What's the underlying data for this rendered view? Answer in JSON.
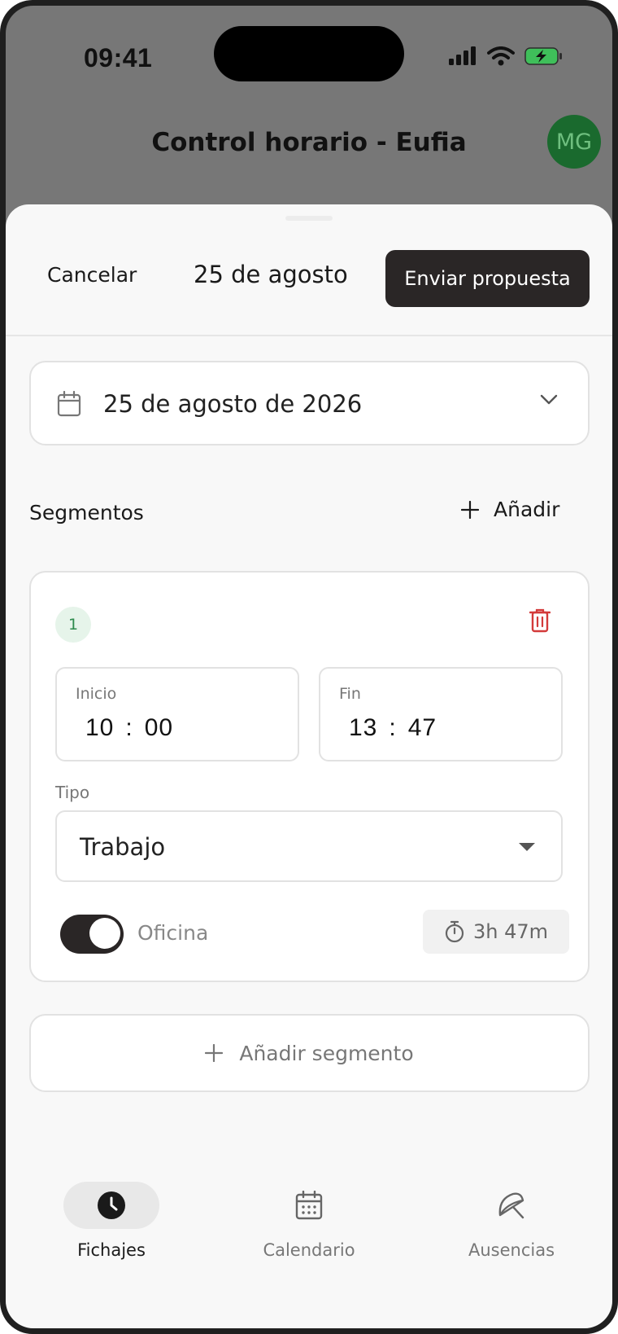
{
  "status_bar": {
    "time": "09:41"
  },
  "header": {
    "title": "Control horario - Eufia",
    "avatar_initials": "MG"
  },
  "sheet": {
    "cancel_label": "Cancelar",
    "title": "25 de agosto",
    "send_label": "Enviar propuesta",
    "date_field": {
      "value": "25 de agosto de 2026",
      "icon": "calendar-icon"
    },
    "segments_heading": "Segmentos",
    "add_label": "Añadir",
    "segment": {
      "number": "1",
      "start_label": "Inicio",
      "start_hour": "10",
      "start_minute": "00",
      "end_label": "Fin",
      "end_hour": "13",
      "end_minute": "47",
      "type_label": "Tipo",
      "type_value": "Trabajo",
      "office_label": "Oficina",
      "office_on": true,
      "duration": "3h 47m"
    },
    "add_segment_label": "Añadir segmento"
  },
  "bottom_nav": {
    "items": [
      {
        "label": "Fichajes",
        "icon": "clock-icon",
        "active": true
      },
      {
        "label": "Calendario",
        "icon": "calendar-icon",
        "active": false
      },
      {
        "label": "Ausencias",
        "icon": "umbrella-icon",
        "active": false
      }
    ]
  },
  "colors": {
    "primary_dark": "#2a2626",
    "avatar_bg": "#1a6a2e",
    "danger": "#d33a3a",
    "badge_green": "#2e8b4e"
  }
}
